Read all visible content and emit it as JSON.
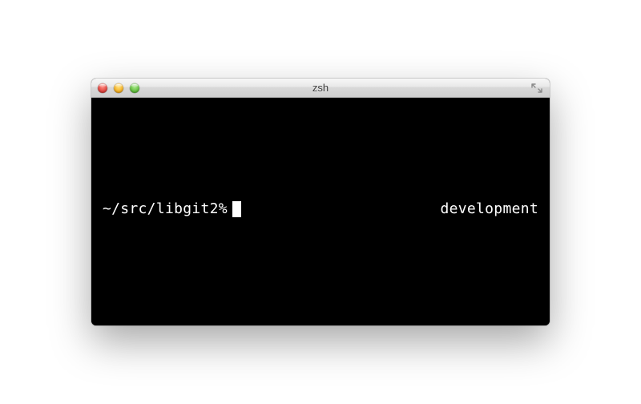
{
  "window": {
    "title": "zsh"
  },
  "terminal": {
    "prompt": "~/src/libgit2%",
    "right_prompt": "development"
  }
}
